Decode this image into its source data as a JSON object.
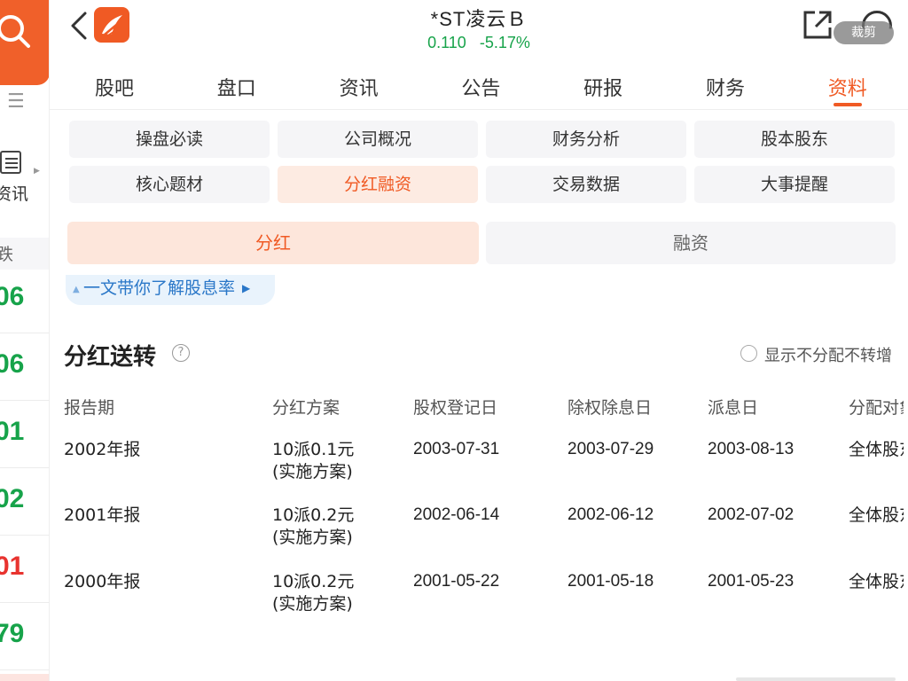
{
  "sidebar": {
    "news_label": "资讯",
    "sort_label": "跌",
    "values": [
      {
        "text": "06",
        "color": "green"
      },
      {
        "text": "06",
        "color": "green"
      },
      {
        "text": "01",
        "color": "green"
      },
      {
        "text": "02",
        "color": "green"
      },
      {
        "text": "01",
        "color": "red"
      },
      {
        "text": "79",
        "color": "green"
      }
    ]
  },
  "header": {
    "title": "*ST凌云Ｂ",
    "price": "0.110",
    "change": "-5.17%",
    "crop_badge": "裁剪"
  },
  "tabs": [
    "股吧",
    "盘口",
    "资讯",
    "公告",
    "研报",
    "财务",
    "资料"
  ],
  "active_tab": 6,
  "sub_tabs": [
    "操盘必读",
    "公司概况",
    "财务分析",
    "股本股东",
    "核心题材",
    "分红融资",
    "交易数据",
    "大事提醒"
  ],
  "active_sub_tab": 5,
  "segment": {
    "left": "分红",
    "right": "融资"
  },
  "banner": {
    "text": "一文带你了解股息率"
  },
  "section": {
    "title": "分红送转",
    "toggle_label": "显示不分配不转增"
  },
  "table": {
    "columns": [
      "报告期",
      "分红方案",
      "股权登记日",
      "除权除息日",
      "派息日",
      "分配对象"
    ],
    "rows": [
      {
        "period": "2002年报",
        "plan": "10派0.1元",
        "plan_status": "(实施方案)",
        "record_date": "2003-07-31",
        "ex_date": "2003-07-29",
        "pay_date": "2003-08-13",
        "target": "全体股东"
      },
      {
        "period": "2001年报",
        "plan": "10派0.2元",
        "plan_status": "(实施方案)",
        "record_date": "2002-06-14",
        "ex_date": "2002-06-12",
        "pay_date": "2002-07-02",
        "target": "全体股东"
      },
      {
        "period": "2000年报",
        "plan": "10派0.2元",
        "plan_status": "(实施方案)",
        "record_date": "2001-05-22",
        "ex_date": "2001-05-18",
        "pay_date": "2001-05-23",
        "target": "全体股东"
      }
    ]
  },
  "colors": {
    "accent": "#f05a24",
    "up": "#e8332f",
    "down": "#17a34a",
    "link": "#2a77c8"
  }
}
